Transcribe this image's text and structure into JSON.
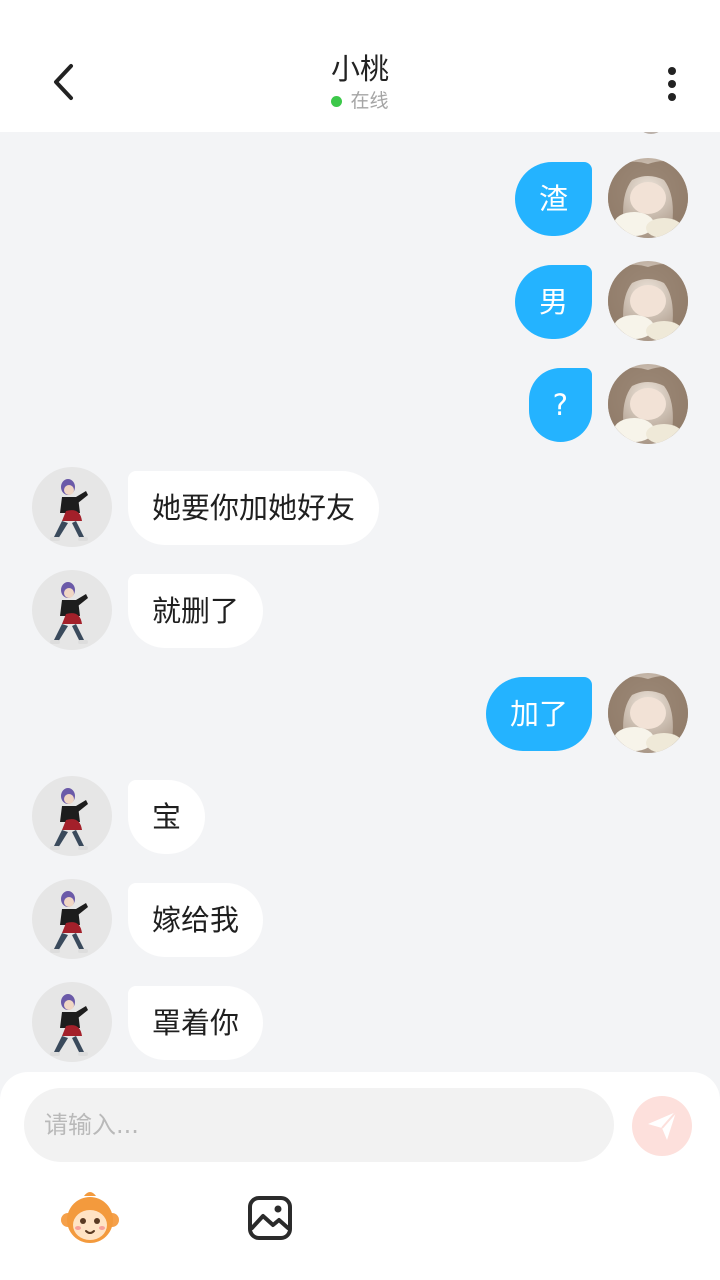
{
  "header": {
    "title": "小桃",
    "status": "在线"
  },
  "messages": [
    {
      "side": "out",
      "text": "渣"
    },
    {
      "side": "out",
      "text": "男"
    },
    {
      "side": "out",
      "text": "?"
    },
    {
      "side": "in",
      "text": "她要你加她好友"
    },
    {
      "side": "in",
      "text": "就删了"
    },
    {
      "side": "out",
      "text": "加了"
    },
    {
      "side": "in",
      "text": "宝"
    },
    {
      "side": "in",
      "text": "嫁给我"
    },
    {
      "side": "in",
      "text": "罩着你"
    }
  ],
  "input": {
    "placeholder": "请输入..."
  },
  "icons": {
    "back": "chevron-left-icon",
    "more": "more-vertical-icon",
    "send": "send-icon",
    "emoji": "monkey-emoji-icon",
    "image": "image-icon"
  },
  "colors": {
    "outgoing_bubble": "#24b3ff",
    "incoming_bubble": "#ffffff",
    "online_dot": "#3cc84a",
    "send_button": "#fde0dc",
    "background": "#f3f4f6"
  }
}
